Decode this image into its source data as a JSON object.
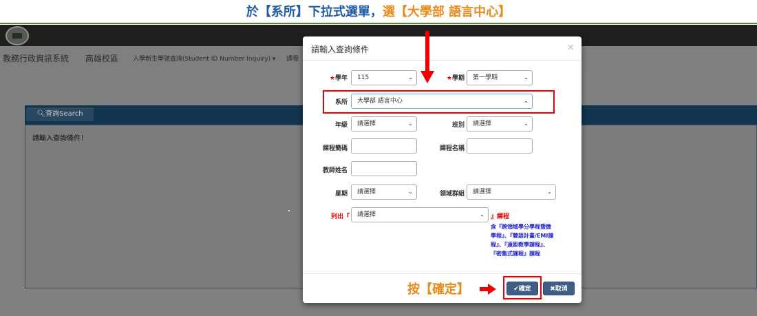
{
  "instruction": {
    "part1": "於【系所】下拉式選單，",
    "part2": "選【大學部 語言中心】"
  },
  "topnav": {
    "items": [
      "教務行政資訊系統",
      "高雄校區",
      "入學新生學號查詢(Student ID Number Inquiry) ▾",
      "課程"
    ]
  },
  "panel": {
    "tab_label": "查詢Search",
    "message": "請輸入查詢條件！"
  },
  "modal": {
    "title": "請輸入查詢條件",
    "close": "×",
    "fields": {
      "year_label": "學年",
      "year_value": "115",
      "term_label": "學期",
      "term_value": "第一學期",
      "dept_label": "系所",
      "dept_value": "大學部 語言中心",
      "grade_label": "年級",
      "grade_value": "請選擇",
      "class_label": "班別",
      "class_value": "請選擇",
      "course_code_label": "課程簡碼",
      "course_name_label": "課程名稱",
      "teacher_label": "教師姓名",
      "weekday_label": "星期",
      "weekday_value": "請選擇",
      "domain_label": "領域群組",
      "domain_value": "請選擇",
      "list_label": "列出『",
      "list_value": "請選擇",
      "list_suffix": "』課程"
    },
    "hint": {
      "line1": "含『跨領域學分學程暨微",
      "line2": "學程』、『雙語計畫/EMI課",
      "line3": "程』、『遠距教學課程』、",
      "line4": "『密集式課程』課程"
    },
    "buttons": {
      "ok": "✔確定",
      "cancel": "✖取消"
    }
  },
  "annotation": {
    "press": "按【確定】"
  },
  "colors": {
    "accent_orange": "#e88a1a",
    "accent_blue": "#1f5aa6",
    "highlight_red": "#e00000"
  }
}
